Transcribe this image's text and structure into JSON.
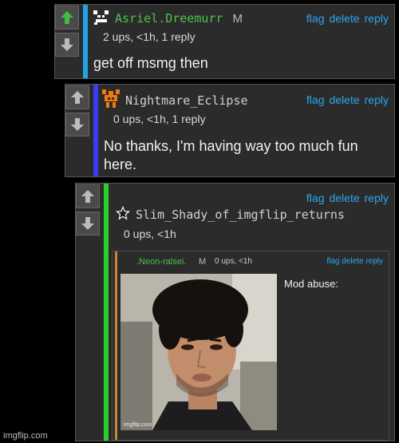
{
  "comments": [
    {
      "username": "Asriel.Dreemurr",
      "mod_badge": "M",
      "meta": "2 ups, <1h, 1 reply",
      "text": "get off msmg then",
      "actions": {
        "flag": "flag",
        "delete": "delete",
        "reply": "reply"
      },
      "colors": {
        "bar": "#1fa5e6",
        "name": "#4cc24c",
        "upvote": "#3fbf3f"
      }
    },
    {
      "username": "Nightmare_Eclipse",
      "meta": "0 ups, <1h, 1 reply",
      "text": "No thanks, I'm having way too much fun here.",
      "actions": {
        "flag": "flag",
        "delete": "delete",
        "reply": "reply"
      },
      "colors": {
        "bar": "#3a3cf0",
        "avatar": "#f07a0c"
      }
    },
    {
      "username": "Slim_Shady_of_imgflip_returns",
      "meta": "0 ups, <1h",
      "actions": {
        "flag": "flag",
        "delete": "delete",
        "reply": "reply"
      },
      "colors": {
        "bar": "#2ad02a"
      },
      "embedded": {
        "username": ".Neon-ralsei.",
        "mod_badge": "M",
        "meta": "0 ups, <1h",
        "actions": {
          "flag": "flag",
          "delete": "delete",
          "reply": "reply"
        },
        "text": "Mod abuse:",
        "photo_watermark": "imgflip.com",
        "colors": {
          "bar": "#c9843a",
          "name": "#4cc24c"
        }
      }
    }
  ],
  "footer": {
    "watermark": "imgflip.com"
  }
}
